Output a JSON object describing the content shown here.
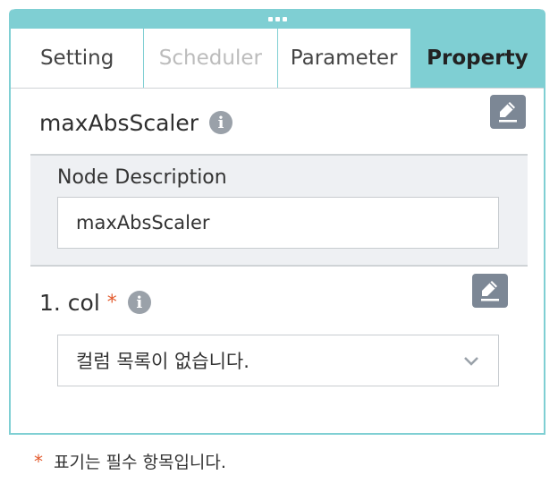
{
  "tabs": [
    {
      "label": "Setting",
      "state": "normal"
    },
    {
      "label": "Scheduler",
      "state": "disabled"
    },
    {
      "label": "Parameter",
      "state": "normal"
    },
    {
      "label": "Property",
      "state": "active"
    }
  ],
  "node": {
    "title": "maxAbsScaler"
  },
  "description": {
    "label": "Node Description",
    "value": "maxAbsScaler"
  },
  "col_field": {
    "label": "1. col",
    "required_mark": "*",
    "select_value": "컬럼 목록이 없습니다."
  },
  "footnote": {
    "mark": "*",
    "text": "표기는 필수 항목입니다."
  },
  "colors": {
    "accent": "#7fcfd3",
    "required": "#e35b2e",
    "edit_button": "#7c8795"
  }
}
